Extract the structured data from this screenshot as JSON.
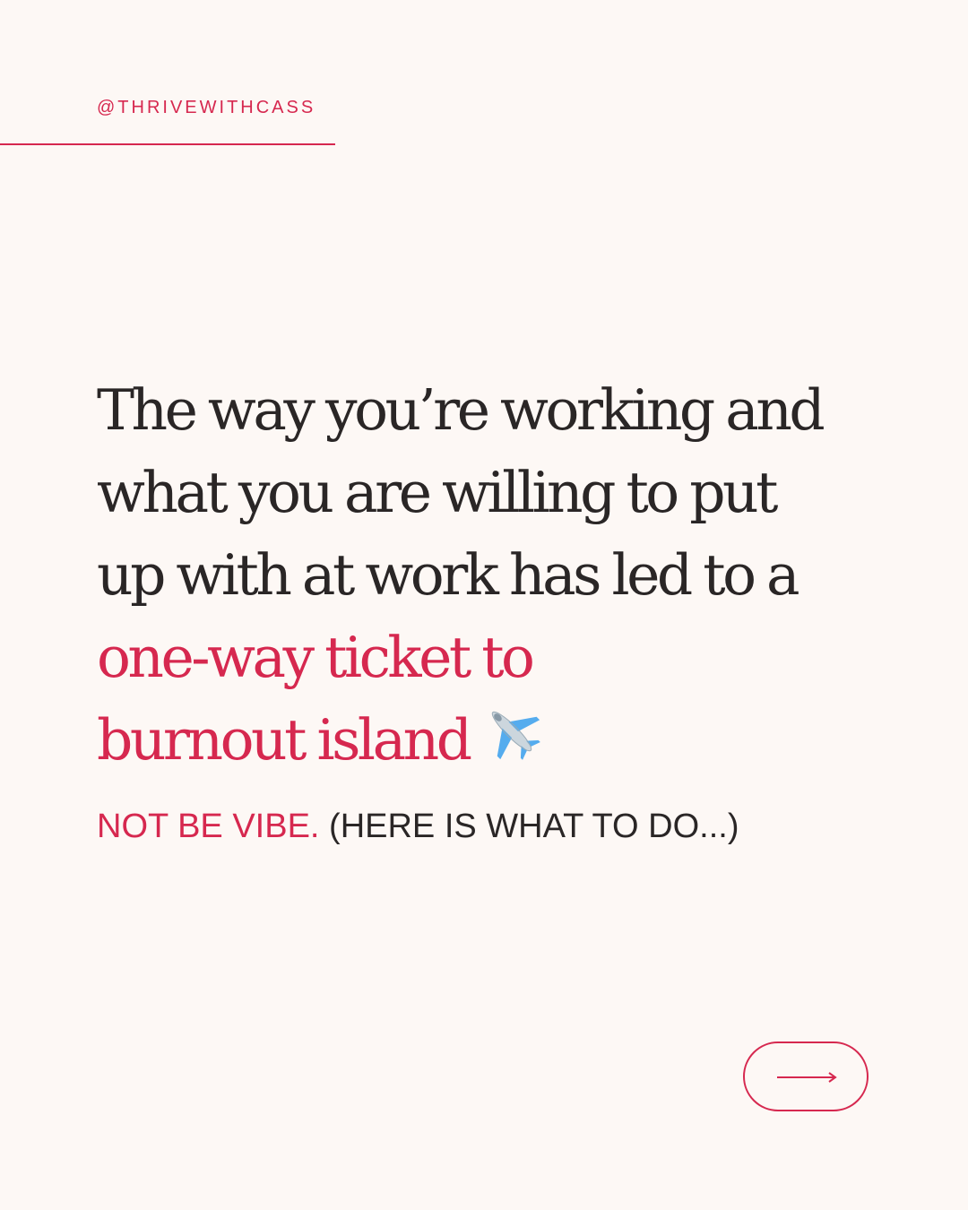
{
  "header": {
    "handle": "@THRIVEWITHCASS"
  },
  "headline": {
    "line1": "The way you’re working and",
    "line2": "what you are willing to put",
    "line3": "up with at work has led to a",
    "accent_line1": "one-way ticket to",
    "accent_line2": "burnout island"
  },
  "subline": {
    "accent": "NOT BE VIBE.",
    "rest": "(HERE IS WHAT TO DO...)"
  },
  "icons": {
    "plane": "airplane-icon",
    "next": "arrow-right-icon"
  },
  "colors": {
    "background": "#fdf8f5",
    "accent": "#d6284f",
    "text": "#2a2626"
  }
}
